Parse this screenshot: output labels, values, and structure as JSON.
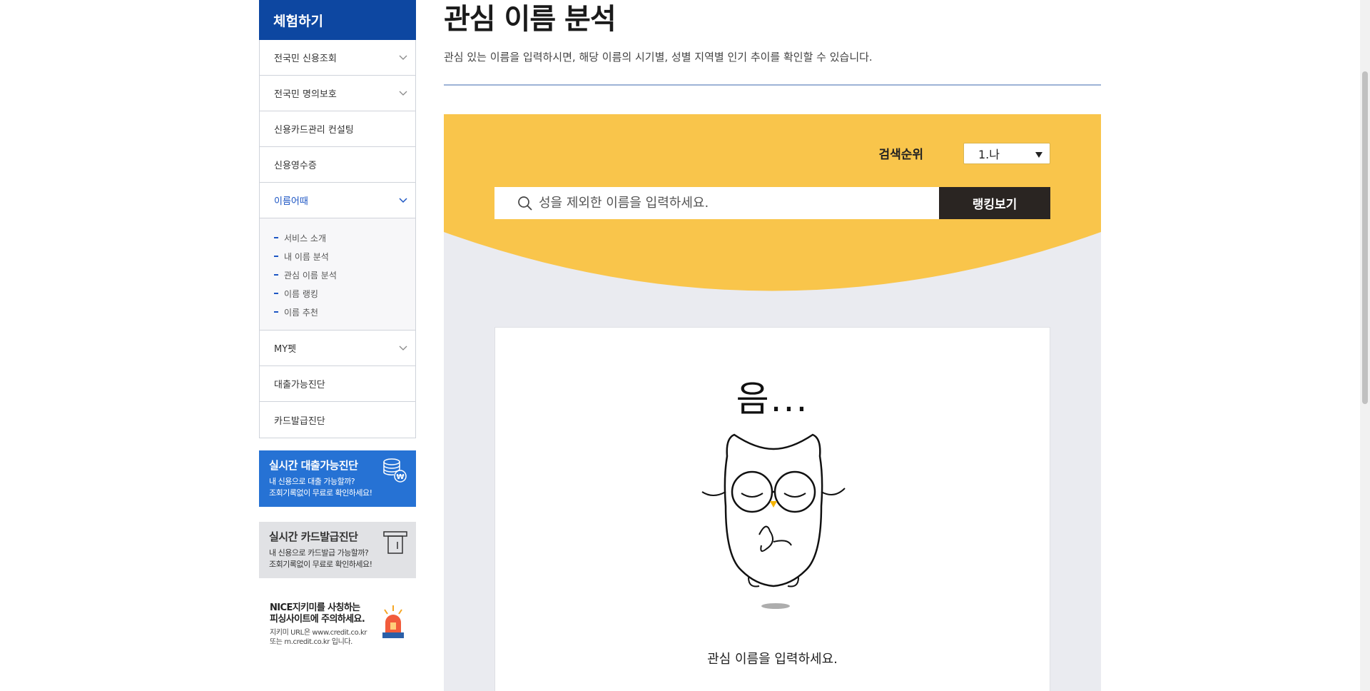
{
  "sidebar": {
    "header": "체험하기",
    "items": [
      {
        "label": "전국민 신용조회",
        "has_chevron": true
      },
      {
        "label": "전국민 명의보호",
        "has_chevron": true
      },
      {
        "label": "신용카드관리 컨설팅",
        "has_chevron": false
      },
      {
        "label": "신용영수증",
        "has_chevron": false
      },
      {
        "label": "이름어때",
        "has_chevron": true,
        "active": true
      },
      {
        "label": "MY펫",
        "has_chevron": true
      },
      {
        "label": "대출가능진단",
        "has_chevron": false
      },
      {
        "label": "카드발급진단",
        "has_chevron": false
      }
    ],
    "submenu": [
      "서비스 소개",
      "내 이름 분석",
      "관심 이름 분석",
      "이름 랭킹",
      "이름 추천"
    ]
  },
  "banners": {
    "loan": {
      "title": "실시간 대출가능진단",
      "line1": "내 신용으로 대출 가능할까?",
      "line2": "조회기록없이 무료로 확인하세요!"
    },
    "card": {
      "title": "실시간 카드발급진단",
      "line1": "내 신용으로 카드발급 가능할까?",
      "line2": "조회기록없이 무료로 확인하세요!"
    },
    "notice": {
      "line1": "NICE지키미를 사칭하는",
      "line2": "피싱사이트에 주의하세요.",
      "line3": "지키미 URL은 www.credit.co.kr",
      "line4": "또는 m.credit.co.kr 입니다."
    }
  },
  "main": {
    "title": "관심 이름 분석",
    "description": "관심 있는 이름을 입력하시면, 해당 이름의 시기별, 성별 지역별 인기 추이를 확인할 수 있습니다.",
    "sort_label": "검색순위",
    "sort_value": "1.나",
    "search_placeholder": "성을 제외한 이름을 입력하세요.",
    "rank_button": "랭킹보기",
    "hmm_text": "음...",
    "result_message": "관심 이름을 입력하세요."
  },
  "colors": {
    "brand_blue": "#0d47a1",
    "banner_blue": "#2672d4",
    "yellow": "#f9c54b",
    "panel_gray": "#eaebf0",
    "button_dark": "#2a2522"
  }
}
